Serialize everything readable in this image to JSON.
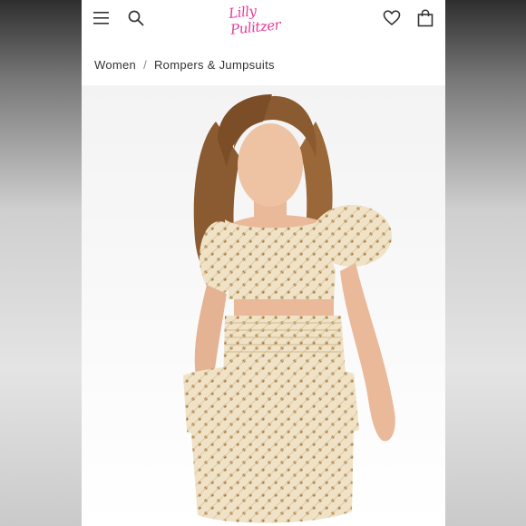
{
  "header": {
    "menu_icon": "menu-icon",
    "search_icon": "search-icon",
    "logo_text": "Lilly Pulitzer",
    "wishlist_icon": "heart-icon",
    "bag_icon": "shopping-bag-icon",
    "brand_color": "#e6399b"
  },
  "breadcrumb": {
    "items": [
      "Women",
      "Rompers & Jumpsuits"
    ],
    "separator": "/"
  },
  "product_image": {
    "description_icon": "model-photo",
    "outfit_color": "#efe2c6",
    "eyelet_color": "#a87a3e",
    "hair_color": "#8a5a30",
    "skin_color": "#e9b99a"
  }
}
